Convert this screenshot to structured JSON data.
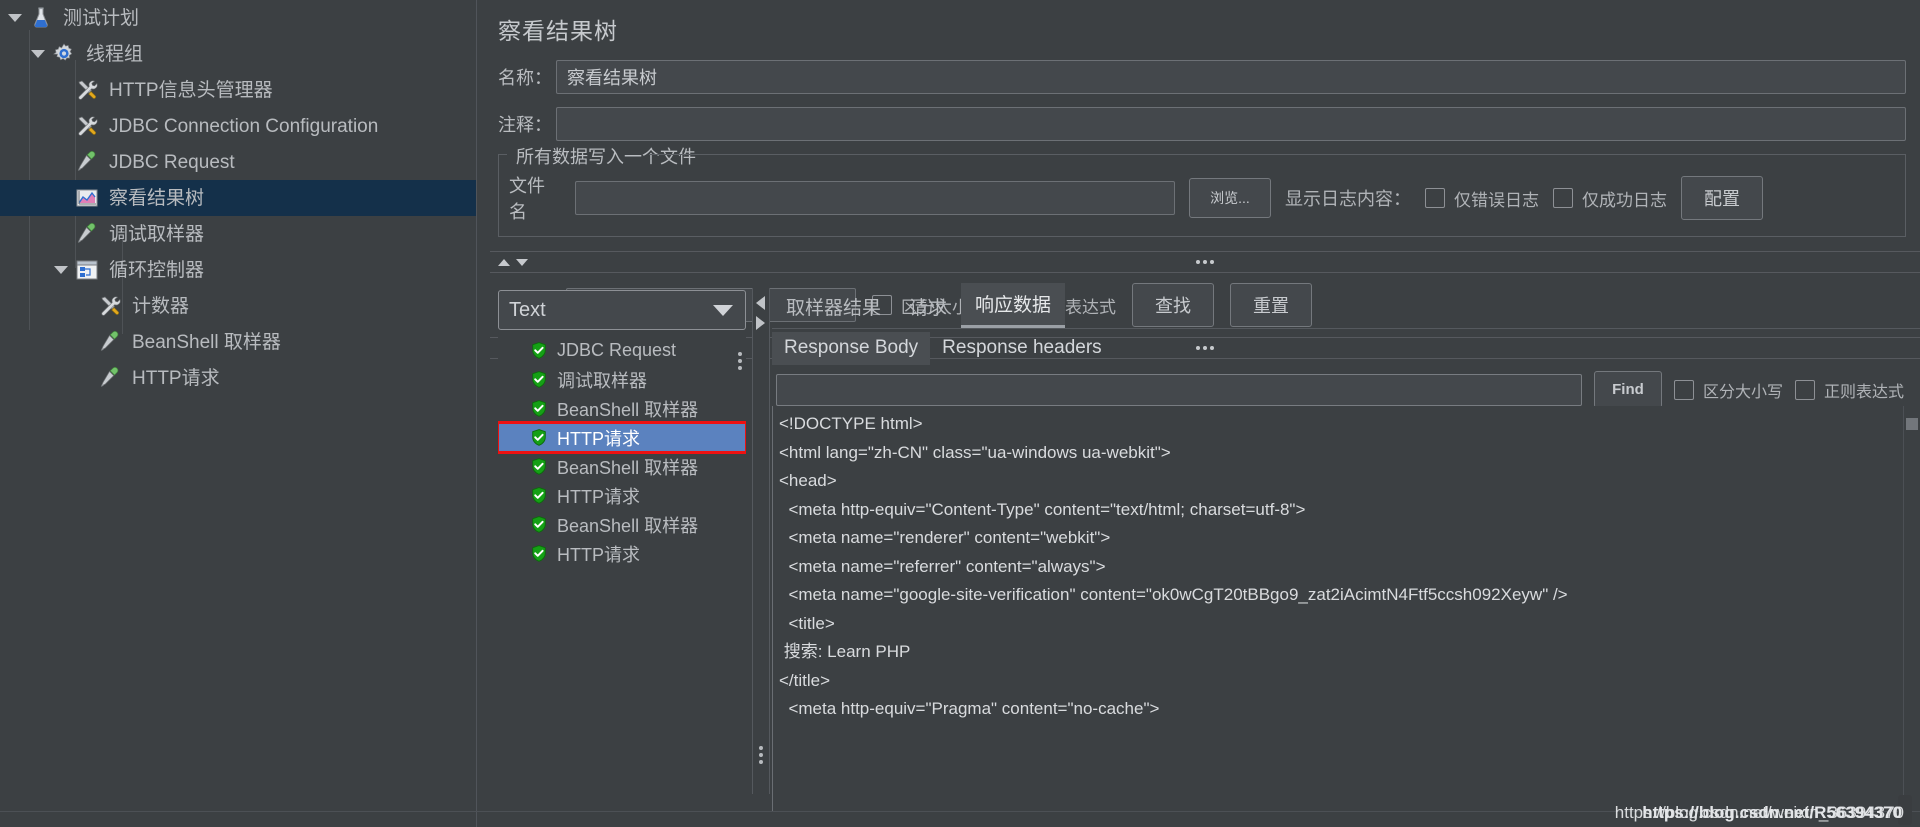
{
  "tree": {
    "items": [
      {
        "label": "测试计划",
        "icon": "flask-icon",
        "indent": 0,
        "twisty": "open",
        "selected": false
      },
      {
        "label": "线程组",
        "icon": "gear-icon",
        "indent": 1,
        "twisty": "open",
        "selected": false
      },
      {
        "label": "HTTP信息头管理器",
        "icon": "tools-icon",
        "indent": 2,
        "twisty": "none",
        "selected": false
      },
      {
        "label": "JDBC Connection Configuration",
        "icon": "tools-icon",
        "indent": 2,
        "twisty": "none",
        "selected": false
      },
      {
        "label": "JDBC Request",
        "icon": "pipette-icon",
        "indent": 2,
        "twisty": "none",
        "selected": false
      },
      {
        "label": "察看结果树",
        "icon": "chart-icon",
        "indent": 2,
        "twisty": "none",
        "selected": true
      },
      {
        "label": "调试取样器",
        "icon": "pipette-icon",
        "indent": 2,
        "twisty": "none",
        "selected": false
      },
      {
        "label": "循环控制器",
        "icon": "controller-icon",
        "indent": 2,
        "twisty": "open",
        "selected": false
      },
      {
        "label": "计数器",
        "icon": "tools-icon",
        "indent": 3,
        "twisty": "none",
        "selected": false
      },
      {
        "label": "BeanShell 取样器",
        "icon": "pipette-icon",
        "indent": 3,
        "twisty": "none",
        "selected": false
      },
      {
        "label": "HTTP请求",
        "icon": "pipette-icon",
        "indent": 3,
        "twisty": "none",
        "selected": false
      }
    ]
  },
  "panel": {
    "title": "察看结果树",
    "name_label": "名称：",
    "name_value": "察看结果树",
    "comment_label": "注释：",
    "comment_value": "",
    "group_title": "所有数据写入一个文件",
    "filename_label": "文件名",
    "filename_value": "",
    "browse_button": "浏览...",
    "log_display_label": "显示日志内容：",
    "errors_only_label": "仅错误日志",
    "success_only_label": "仅成功日志",
    "configure_button": "配置"
  },
  "search": {
    "label": "查找:",
    "value": "",
    "case_label": "区分大小写",
    "regex_label": "正则表达式",
    "find_button": "查找",
    "reset_button": "重置"
  },
  "results": {
    "renderer_selected": "Text",
    "samplers": [
      {
        "label": "JDBC Request",
        "status": "success",
        "selected": false
      },
      {
        "label": "调试取样器",
        "status": "success",
        "selected": false
      },
      {
        "label": "BeanShell 取样器",
        "status": "success",
        "selected": false
      },
      {
        "label": "HTTP请求",
        "status": "success",
        "selected": true
      },
      {
        "label": "BeanShell 取样器",
        "status": "success",
        "selected": false
      },
      {
        "label": "HTTP请求",
        "status": "success",
        "selected": false
      },
      {
        "label": "BeanShell 取样器",
        "status": "success",
        "selected": false
      },
      {
        "label": "HTTP请求",
        "status": "success",
        "selected": false
      }
    ]
  },
  "detail": {
    "tabs": [
      {
        "label": "取样器结果",
        "active": false
      },
      {
        "label": "请求",
        "active": false
      },
      {
        "label": "响应数据",
        "active": true
      }
    ],
    "subtabs": [
      {
        "label": "Response Body",
        "active": true
      },
      {
        "label": "Response headers",
        "active": false
      }
    ],
    "find": {
      "value": "",
      "button": "Find",
      "case_label": "区分大小写",
      "regex_label": "正则表达式"
    },
    "response_body_lines": [
      "<!DOCTYPE html>",
      "<html lang=\"zh-CN\" class=\"ua-windows ua-webkit\">",
      "<head>",
      "  <meta http-equiv=\"Content-Type\" content=\"text/html; charset=utf-8\">",
      "  <meta name=\"renderer\" content=\"webkit\">",
      "  <meta name=\"referrer\" content=\"always\">",
      "  <meta name=\"google-site-verification\" content=\"ok0wCgT20tBBgo9_zat2iAcimtN4Ftf5ccsh092Xeyw\" />",
      "  <title>",
      " 搜索: Learn PHP",
      "</title>",
      "",
      "",
      "  <meta http-equiv=\"Pragma\" content=\"no-cache\">"
    ]
  },
  "watermark": {
    "line_a": "https://blog.csdn.net/weixin_36394370",
    "line_b": "https://blog.csdn.net/R56394370"
  },
  "colors": {
    "background": "#3c4043",
    "tree_selection": "#14304a",
    "list_selection": "#5b82bf",
    "highlight_box": "#ee1111",
    "success_green": "#16a316",
    "text": "#b9bcc0"
  }
}
